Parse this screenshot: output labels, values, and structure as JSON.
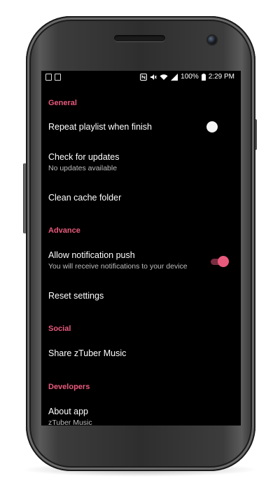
{
  "status_bar": {
    "battery": "100%",
    "time": "2:29 PM"
  },
  "settings": {
    "general_header": "General",
    "repeat_playlist": {
      "title": "Repeat playlist when finish",
      "enabled": false
    },
    "check_updates": {
      "title": "Check for updates",
      "subtitle": "No updates available"
    },
    "clean_cache": {
      "title": "Clean cache folder"
    },
    "advance_header": "Advance",
    "notification_push": {
      "title": "Allow notification push",
      "subtitle": "You will receive notifications to your device",
      "enabled": true
    },
    "reset_settings": {
      "title": "Reset settings"
    },
    "social_header": "Social",
    "share": {
      "title": "Share zTuber Music"
    },
    "developers_header": "Developers",
    "about": {
      "title": "About app",
      "subtitle": "zTuber Music"
    }
  },
  "colors": {
    "accent": "#e85a7c",
    "background": "#000000",
    "text": "#ffffff",
    "subtext": "#bdbdbd"
  },
  "icons": {
    "status_left": [
      "screenshot-icon",
      "clipboard-icon"
    ],
    "status_right": [
      "nfc-icon",
      "mute-icon",
      "wifi-icon",
      "signal-icon",
      "battery-icon"
    ]
  }
}
